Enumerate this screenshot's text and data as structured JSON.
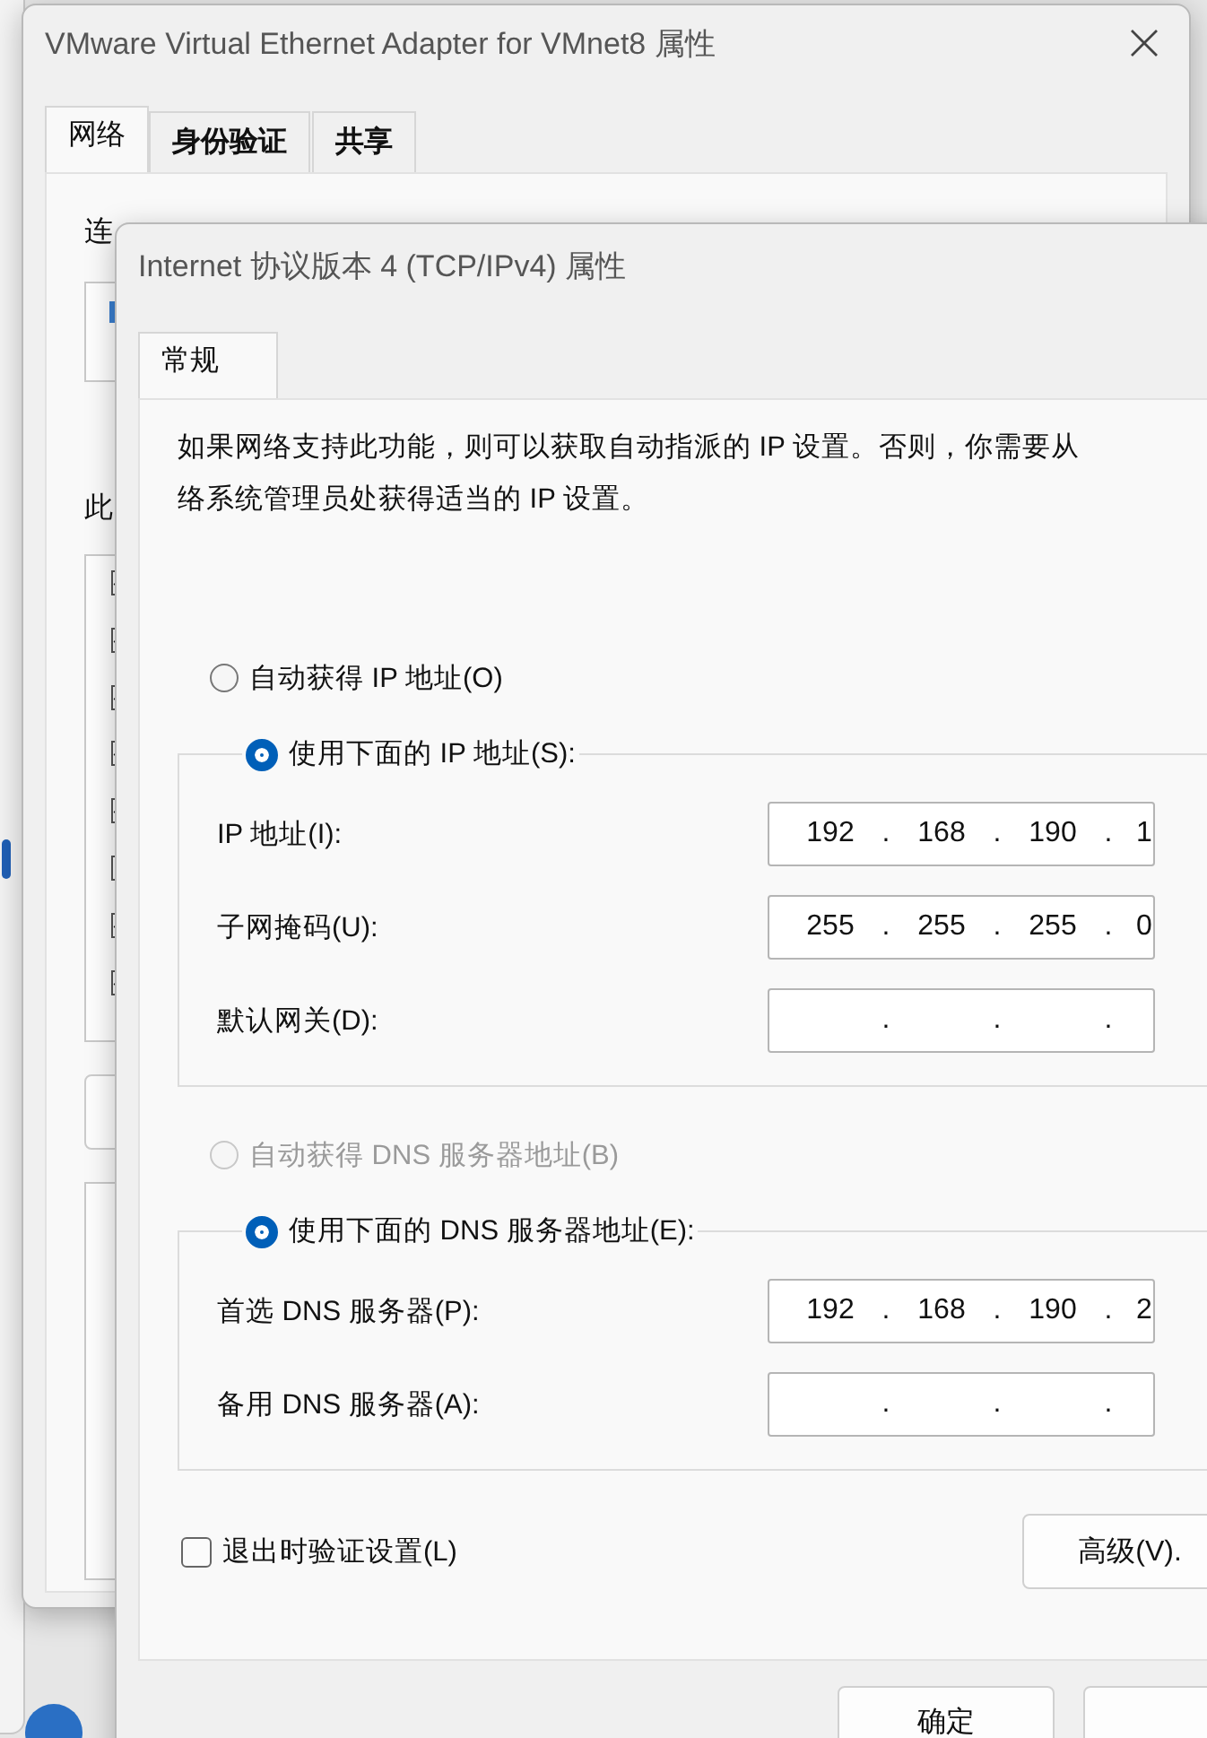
{
  "background_window": {
    "title": "VMware Virtual Ethernet Adapter for VMnet8 属性",
    "tabs": [
      {
        "label": "网络",
        "selected": true
      },
      {
        "label": "身份验证",
        "selected": false
      },
      {
        "label": "共享",
        "selected": false
      }
    ],
    "connect_label": "连",
    "components_label": "此",
    "component_checkboxes": [
      {
        "checked": true
      },
      {
        "checked": true
      },
      {
        "checked": true
      },
      {
        "checked": true
      },
      {
        "checked": true
      },
      {
        "checked": false
      },
      {
        "checked": true
      },
      {
        "checked": true
      }
    ]
  },
  "dialog": {
    "title": "Internet 协议版本 4 (TCP/IPv4) 属性",
    "tabs": [
      {
        "label": "常规",
        "selected": true
      }
    ],
    "description": [
      "如果网络支持此功能，则可以获取自动指派的 IP 设置。否则，你需要从",
      "络系统管理员处获得适当的 IP 设置。"
    ],
    "ip_separator": ".",
    "ip_mode": [
      {
        "label": "自动获得 IP 地址(O)",
        "selected": false,
        "disabled": false
      },
      {
        "label": "使用下面的 IP 地址(S):",
        "selected": true,
        "disabled": false
      }
    ],
    "ip_fields": [
      {
        "label": "IP 地址(I):",
        "octets": [
          "192",
          "168",
          "190",
          "1"
        ]
      },
      {
        "label": "子网掩码(U):",
        "octets": [
          "255",
          "255",
          "255",
          "0"
        ]
      },
      {
        "label": "默认网关(D):"
      }
    ],
    "dns_mode": [
      {
        "label": "自动获得 DNS 服务器地址(B)",
        "selected": false,
        "disabled": true
      },
      {
        "label": "使用下面的 DNS 服务器地址(E):",
        "selected": true,
        "disabled": false
      }
    ],
    "dns_fields": [
      {
        "label": "首选 DNS 服务器(P):",
        "octets": [
          "192",
          "168",
          "190",
          "2"
        ]
      },
      {
        "label": "备用 DNS 服务器(A):"
      }
    ],
    "validate_on_exit": {
      "label": "退出时验证设置(L)",
      "checked": false
    },
    "advanced_button": "高级(V).",
    "footer_buttons": [
      "确定"
    ]
  }
}
